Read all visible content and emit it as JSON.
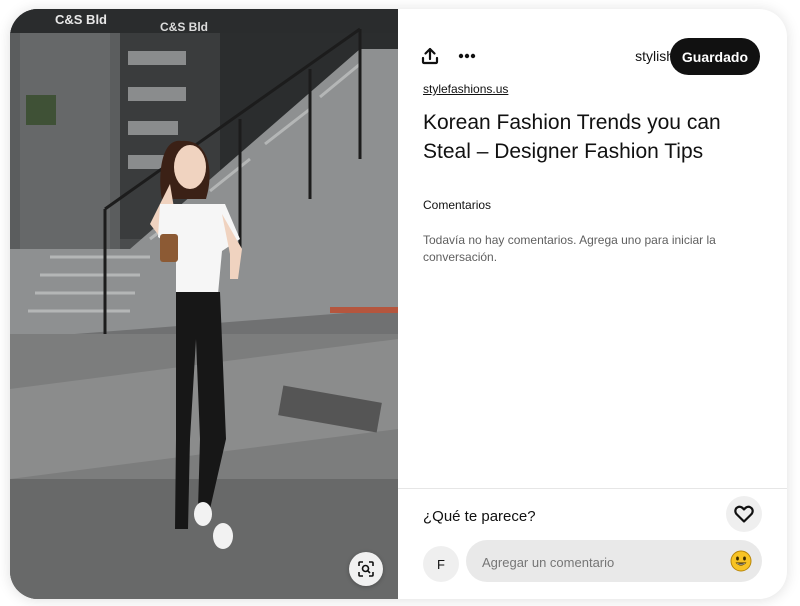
{
  "pin": {
    "image_sign_text_1": "C&S Bld",
    "image_sign_text_2": "C&S Bld"
  },
  "toolbar": {
    "share_icon": "share-upload-icon",
    "more_icon": "ellipsis-icon",
    "board_name": "stylish",
    "saved_label": "Guardado"
  },
  "details": {
    "source": "stylefashions.us",
    "title": "Korean Fashion Trends you can Steal – Designer Fashion Tips"
  },
  "comments": {
    "heading": "Comentarios",
    "empty_message": "Todavía no hay comentarios. Agrega uno para iniciar la conversación."
  },
  "footer": {
    "prompt": "¿Qué te parece?",
    "avatar_initial": "F",
    "comment_placeholder": "Agregar un comentario",
    "like_icon": "heart-outline-icon",
    "emoji_icon": "smiley-emoji-icon",
    "lens_icon": "visual-search-icon"
  },
  "colors": {
    "saved_button_bg": "#111111",
    "panel_bg": "#ffffff",
    "input_bg": "#e9e9e9",
    "emoji_yellow": "#f7c324"
  }
}
